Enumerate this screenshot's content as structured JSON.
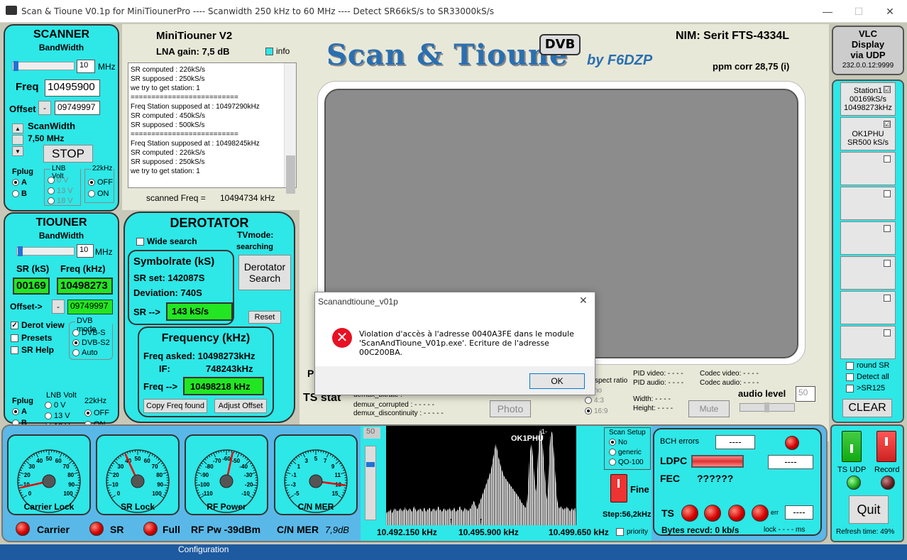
{
  "window": {
    "title": "Scan & Tioune V0.1p for MiniTiounerPro ---- Scanwidth 250 kHz to 60 MHz ---- Detect SR66kS/s to SR33000kS/s",
    "min": "—",
    "max": "☐",
    "close": "✕"
  },
  "scanner": {
    "title": "SCANNER",
    "bandwidth_label": "BandWidth",
    "bandwidth": "10",
    "mhz": "MHz",
    "freq_label": "Freq",
    "freq": "10495900",
    "offset_label": "Offset",
    "offset_minus": "-",
    "offset": "09749997",
    "scanwidth_label": "ScanWidth",
    "scanwidth_value": "7,50 MHz",
    "stop": "STOP",
    "fplug": "Fplug",
    "a": "A",
    "b": "B",
    "lnb_volt": "LNB Volt",
    "v0": "0 V",
    "v13": "13 V",
    "v18": "18 V",
    "k22": "22kHz",
    "off": "OFF",
    "on": "ON"
  },
  "tiouner": {
    "title": "TIOUNER",
    "bandwidth_label": "BandWidth",
    "bandwidth": "10",
    "mhz": "MHz",
    "sr_label": "SR (kS)",
    "freq_label": "Freq (kHz)",
    "sr": "00169",
    "freq": "10498273",
    "offset_label": "Offset->",
    "offset_minus": "-",
    "offset": "09749997",
    "derot_view": "Derot view",
    "presets": "Presets",
    "sr_help": "SR Help",
    "dvb_mode": "DVB mode",
    "dvbs": "DVB-S",
    "dvbs2": "DVB-S2",
    "auto": "Auto",
    "fplug": "Fplug",
    "a": "A",
    "b": "B",
    "lnb_volt": "LNB Volt",
    "v0": "0 V",
    "v13": "13 V",
    "v18": "18 V",
    "k22": "22kHz",
    "off": "OFF",
    "on": "ON"
  },
  "minitiouner": {
    "title": "MiniTiouner V2",
    "lna": "LNA gain: 7,5 dB",
    "info": "info",
    "scanned_label": "scanned Freq =",
    "scanned": "10494734 kHz"
  },
  "log": [
    "SR computed : 226kS/s",
    "SR supposed : 250kS/s",
    "we try  to get station: 1",
    "==========================",
    "Freq Station supposed at : 10497290kHz",
    "SR computed : 450kS/s",
    "SR supposed : 500kS/s",
    "==========================",
    "Freq Station supposed at : 10498245kHz",
    "SR computed : 226kS/s",
    "SR supposed : 250kS/s",
    "we try  to get station: 1"
  ],
  "logo": {
    "main": "Scan & Tioune",
    "dvb": "DVB",
    "by": "by F6DZP"
  },
  "nim": {
    "label": "NIM: Serit FTS-4334L",
    "ppm": "ppm corr  28,75 (i)"
  },
  "vlc": {
    "l1": "VLC",
    "l2": "Display",
    "l3": "via UDP",
    "ip": "232.0.0.12:9999"
  },
  "derotator": {
    "title": "DEROTATOR",
    "wide": "Wide search",
    "tvmode": "TVmode:",
    "searching": "searching",
    "sym_title": "Symbolrate (kS)",
    "srset": "SR set:  142087S",
    "deviation": "Deviation:  740S",
    "sr_arrow": "SR -->",
    "sr_val": "143 kS/s",
    "derot_btn1": "Derotator",
    "derot_btn2": "Search",
    "reset": "Reset",
    "freq_title": "Frequency (kHz)",
    "freq_asked": "Freq asked:  10498273kHz",
    "if_label": "IF:",
    "if_val": "748243kHz",
    "freq_arrow": "Freq -->",
    "freq_val": "10498218 kHz",
    "copy": "Copy Freq found",
    "adjust": "Adjust Offset"
  },
  "stations": [
    {
      "l1": "Station1",
      "l2": "00169kS/s",
      "l3": "10498273kHz",
      "checked": "☑"
    },
    {
      "l1": "OK1PHU",
      "l2": "SR500 kS/s",
      "l3": "",
      "checked": "☑"
    }
  ],
  "station_opts": {
    "round": "round SR",
    "detect": "Detect all",
    "sr125": ">SR125",
    "clear": "CLEAR"
  },
  "ts": {
    "p": "P",
    "ts_stat": "TS stat",
    "bitrate": "demux_bitrate : - - - - -",
    "corrupted": "demux_corrupted : - - - - -",
    "discontinuity": "demux_discontinuity : - - - - -",
    "photo": "Photo",
    "aspect": "spect ratio",
    "no": "no",
    "r43": "4:3",
    "r169": "16:9",
    "pid_video": "PID video: - - - -",
    "pid_audio": "PID audio: - - - -",
    "codec_video": "Codec video: - - - -",
    "codec_audio": "Codec audio: - - - -",
    "width": "Width:   - - - -",
    "height": "Height:   - - - -",
    "mute": "Mute",
    "audio_level": "audio level",
    "audio_val": "50"
  },
  "dialog": {
    "title": "Scanandtioune_v01p",
    "message": "Violation d'accès à l'adresse 0040A3FE dans le module 'ScanAndTioune_V01p.exe'. Ecriture de l'adresse 00C200BA.",
    "ok": "OK",
    "close": "✕"
  },
  "gauges": [
    {
      "label": "Carrier Lock",
      "ticks": [
        "0",
        "10",
        "20",
        "30",
        "40",
        "50",
        "60",
        "70",
        "80",
        "90",
        "100"
      ],
      "value": 8
    },
    {
      "label": "SR Lock",
      "ticks": [
        "0",
        "10",
        "20",
        "30",
        "40",
        "50",
        "60",
        "70",
        "80",
        "90",
        "100"
      ],
      "value": 40
    },
    {
      "label": "RF Power",
      "ticks": [
        "-110",
        "-100",
        "-90",
        "-80",
        "-70",
        "-60",
        "-50",
        "-40",
        "-30",
        "-20",
        "-10"
      ],
      "value": -55
    },
    {
      "label": "C/N MER",
      "ticks": [
        "-5",
        "-3",
        "-1",
        "1",
        "3",
        "5",
        "7",
        "9",
        "11",
        "13",
        "15"
      ],
      "value": 13
    }
  ],
  "leds": {
    "carrier": "Carrier",
    "sr": "SR",
    "full": "Full",
    "rfpw": "RF Pw -39dBm",
    "cnmer": "C/N MER",
    "cnmer_val": "7,9dB"
  },
  "spectrum": {
    "level": "50",
    "station": "OK1PHU",
    "sup": "-1-",
    "f1": "10.492.150 kHz",
    "f2": "10.495.900 kHz",
    "f3": "10.499.650 kHz",
    "priority": "priority",
    "scan_setup": "Scan Setup",
    "no": "No",
    "generic": "generic",
    "qo100": "QO-100",
    "fine": "Fine",
    "step": "Step:56,2kHz",
    "heights": [
      8,
      10,
      9,
      11,
      10,
      12,
      9,
      10,
      11,
      13,
      12,
      10,
      11,
      10,
      12,
      13,
      11,
      10,
      12,
      11,
      14,
      12,
      10,
      11,
      13,
      12,
      11,
      10,
      12,
      14,
      13,
      11,
      10,
      12,
      11,
      13,
      12,
      11,
      10,
      12,
      13,
      11,
      10,
      12,
      11,
      13,
      12,
      10,
      11,
      12,
      13,
      11,
      10,
      12,
      14,
      13,
      11,
      12,
      10,
      11,
      12,
      13,
      11,
      10,
      12,
      11,
      13,
      12,
      10,
      11,
      12,
      13,
      11,
      10,
      12,
      11,
      13,
      14,
      12,
      11,
      10,
      12,
      13,
      11,
      12,
      10,
      11,
      13,
      12,
      14,
      16,
      18,
      17,
      15,
      13,
      12,
      14,
      16,
      18,
      20,
      22,
      24,
      26,
      28,
      30,
      32,
      34,
      36,
      38,
      40,
      44,
      48,
      52,
      56,
      60,
      58,
      55,
      50,
      48,
      45,
      42,
      40,
      38,
      36,
      35,
      34,
      33,
      32,
      31,
      30,
      29,
      28,
      27,
      26,
      25,
      24,
      23,
      22,
      21,
      20,
      18,
      17,
      16,
      15,
      14,
      13,
      14,
      20,
      30,
      45,
      55,
      60,
      58,
      50,
      40,
      30,
      25,
      35,
      50,
      62,
      70,
      72,
      68,
      60,
      50,
      40,
      30,
      22,
      18,
      35,
      55,
      65,
      70,
      68,
      60,
      50,
      40,
      30,
      20,
      15,
      13,
      12,
      14,
      13,
      12,
      11,
      13,
      12,
      14,
      13,
      12,
      11,
      10,
      12,
      13,
      11,
      12,
      13
    ]
  },
  "bch": {
    "errors_label": "BCH errors",
    "errors": "----",
    "ldpc": "LDPC",
    "ldpc_val": "----",
    "fec": "FEC",
    "fec_val": "??????",
    "ts": "TS",
    "err": "err",
    "err_val": "----",
    "bytes": "Bytes recvd: 0 kb/s",
    "lock": "lock - - - - ms"
  },
  "right_bottom": {
    "ts_udp": "TS UDP",
    "record": "Record",
    "quit": "Quit",
    "refresh": "Refresh time:  49%"
  },
  "taskbar": {
    "config": "Configuration"
  },
  "colors": {
    "panel": "#2ee7e7",
    "green": "#22e622",
    "led_red": "#d40000",
    "bg": "#c8c8b8"
  }
}
